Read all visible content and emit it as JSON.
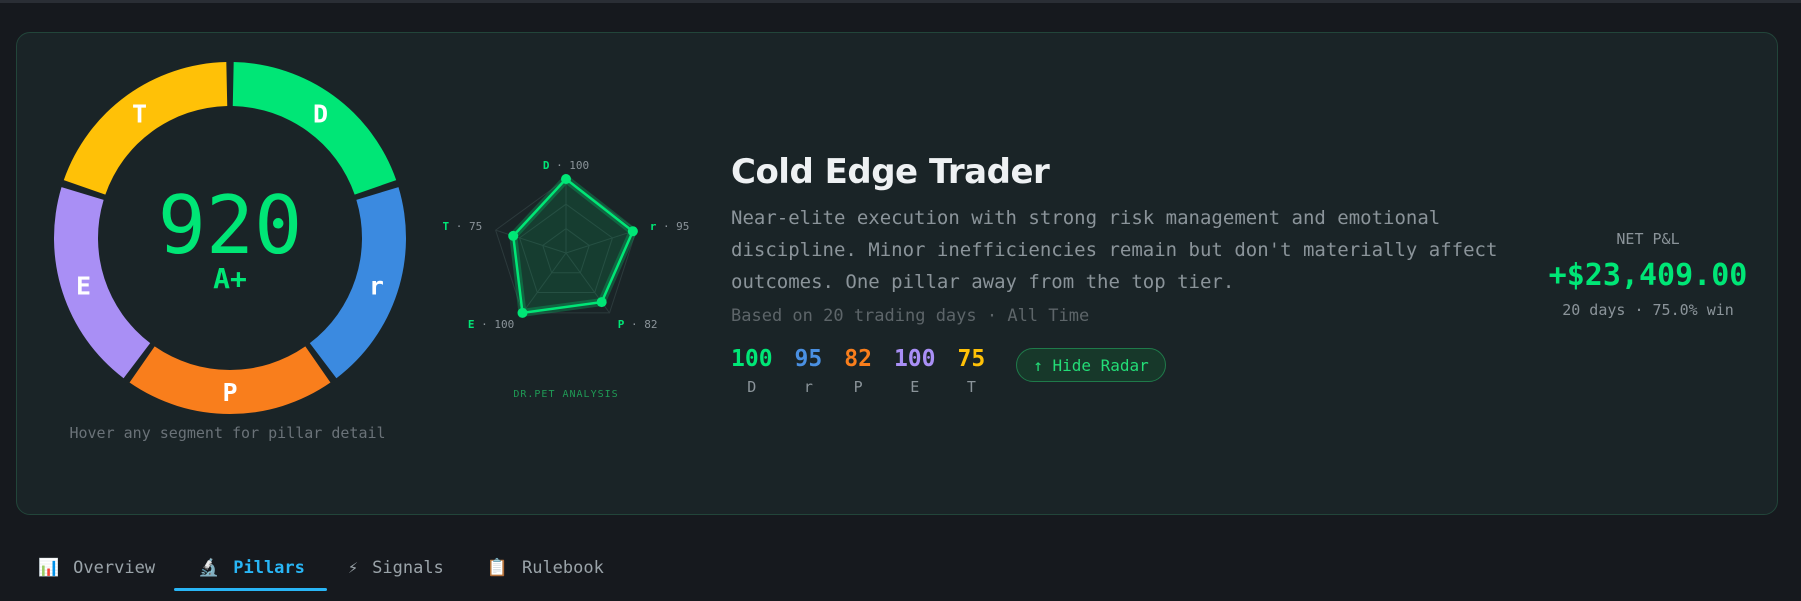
{
  "score": {
    "value": "920",
    "grade": "A+",
    "hint": "Hover any segment for pillar detail"
  },
  "donut_segments": [
    {
      "letter": "D",
      "color": "#00e676"
    },
    {
      "letter": "r",
      "color": "#3b8ae0"
    },
    {
      "letter": "P",
      "color": "#f97e1c"
    },
    {
      "letter": "E",
      "color": "#a98ff5"
    },
    {
      "letter": "T",
      "color": "#ffc107"
    }
  ],
  "radar": {
    "caption": "DR.PET ANALYSIS",
    "axes": [
      {
        "letter": "D",
        "value": 100,
        "label": "· 100"
      },
      {
        "letter": "r",
        "value": 95,
        "label": "· 95"
      },
      {
        "letter": "P",
        "value": 82,
        "label": "· 82"
      },
      {
        "letter": "E",
        "value": 100,
        "label": "· 100"
      },
      {
        "letter": "T",
        "value": 75,
        "label": "· 75"
      }
    ]
  },
  "profile": {
    "title": "Cold Edge Trader",
    "description": "Near-elite execution with strong risk management and emotional discipline. Minor inefficiencies remain but don't materially affect outcomes. One pillar away from the top tier.",
    "based_on": "Based on 20 trading days · All Time"
  },
  "pillars": [
    {
      "value": "100",
      "label": "D",
      "color": "#00e676"
    },
    {
      "value": "95",
      "label": "r",
      "color": "#4a90e2"
    },
    {
      "value": "82",
      "label": "P",
      "color": "#f97e1c"
    },
    {
      "value": "100",
      "label": "E",
      "color": "#a98ff5"
    },
    {
      "value": "75",
      "label": "T",
      "color": "#ffc107"
    }
  ],
  "hide_radar_label": "↑ Hide Radar",
  "pnl": {
    "label": "NET P&L",
    "value": "+$23,409.00",
    "sub": "20 days · 75.0% win"
  },
  "tabs": [
    {
      "label": "Overview",
      "icon": "📊",
      "icon_name": "chart-icon"
    },
    {
      "label": "Pillars",
      "icon": "🔬",
      "icon_name": "microscope-icon",
      "active": true
    },
    {
      "label": "Signals",
      "icon": "⚡",
      "icon_name": "lightning-icon"
    },
    {
      "label": "Rulebook",
      "icon": "📋",
      "icon_name": "clipboard-icon"
    }
  ]
}
